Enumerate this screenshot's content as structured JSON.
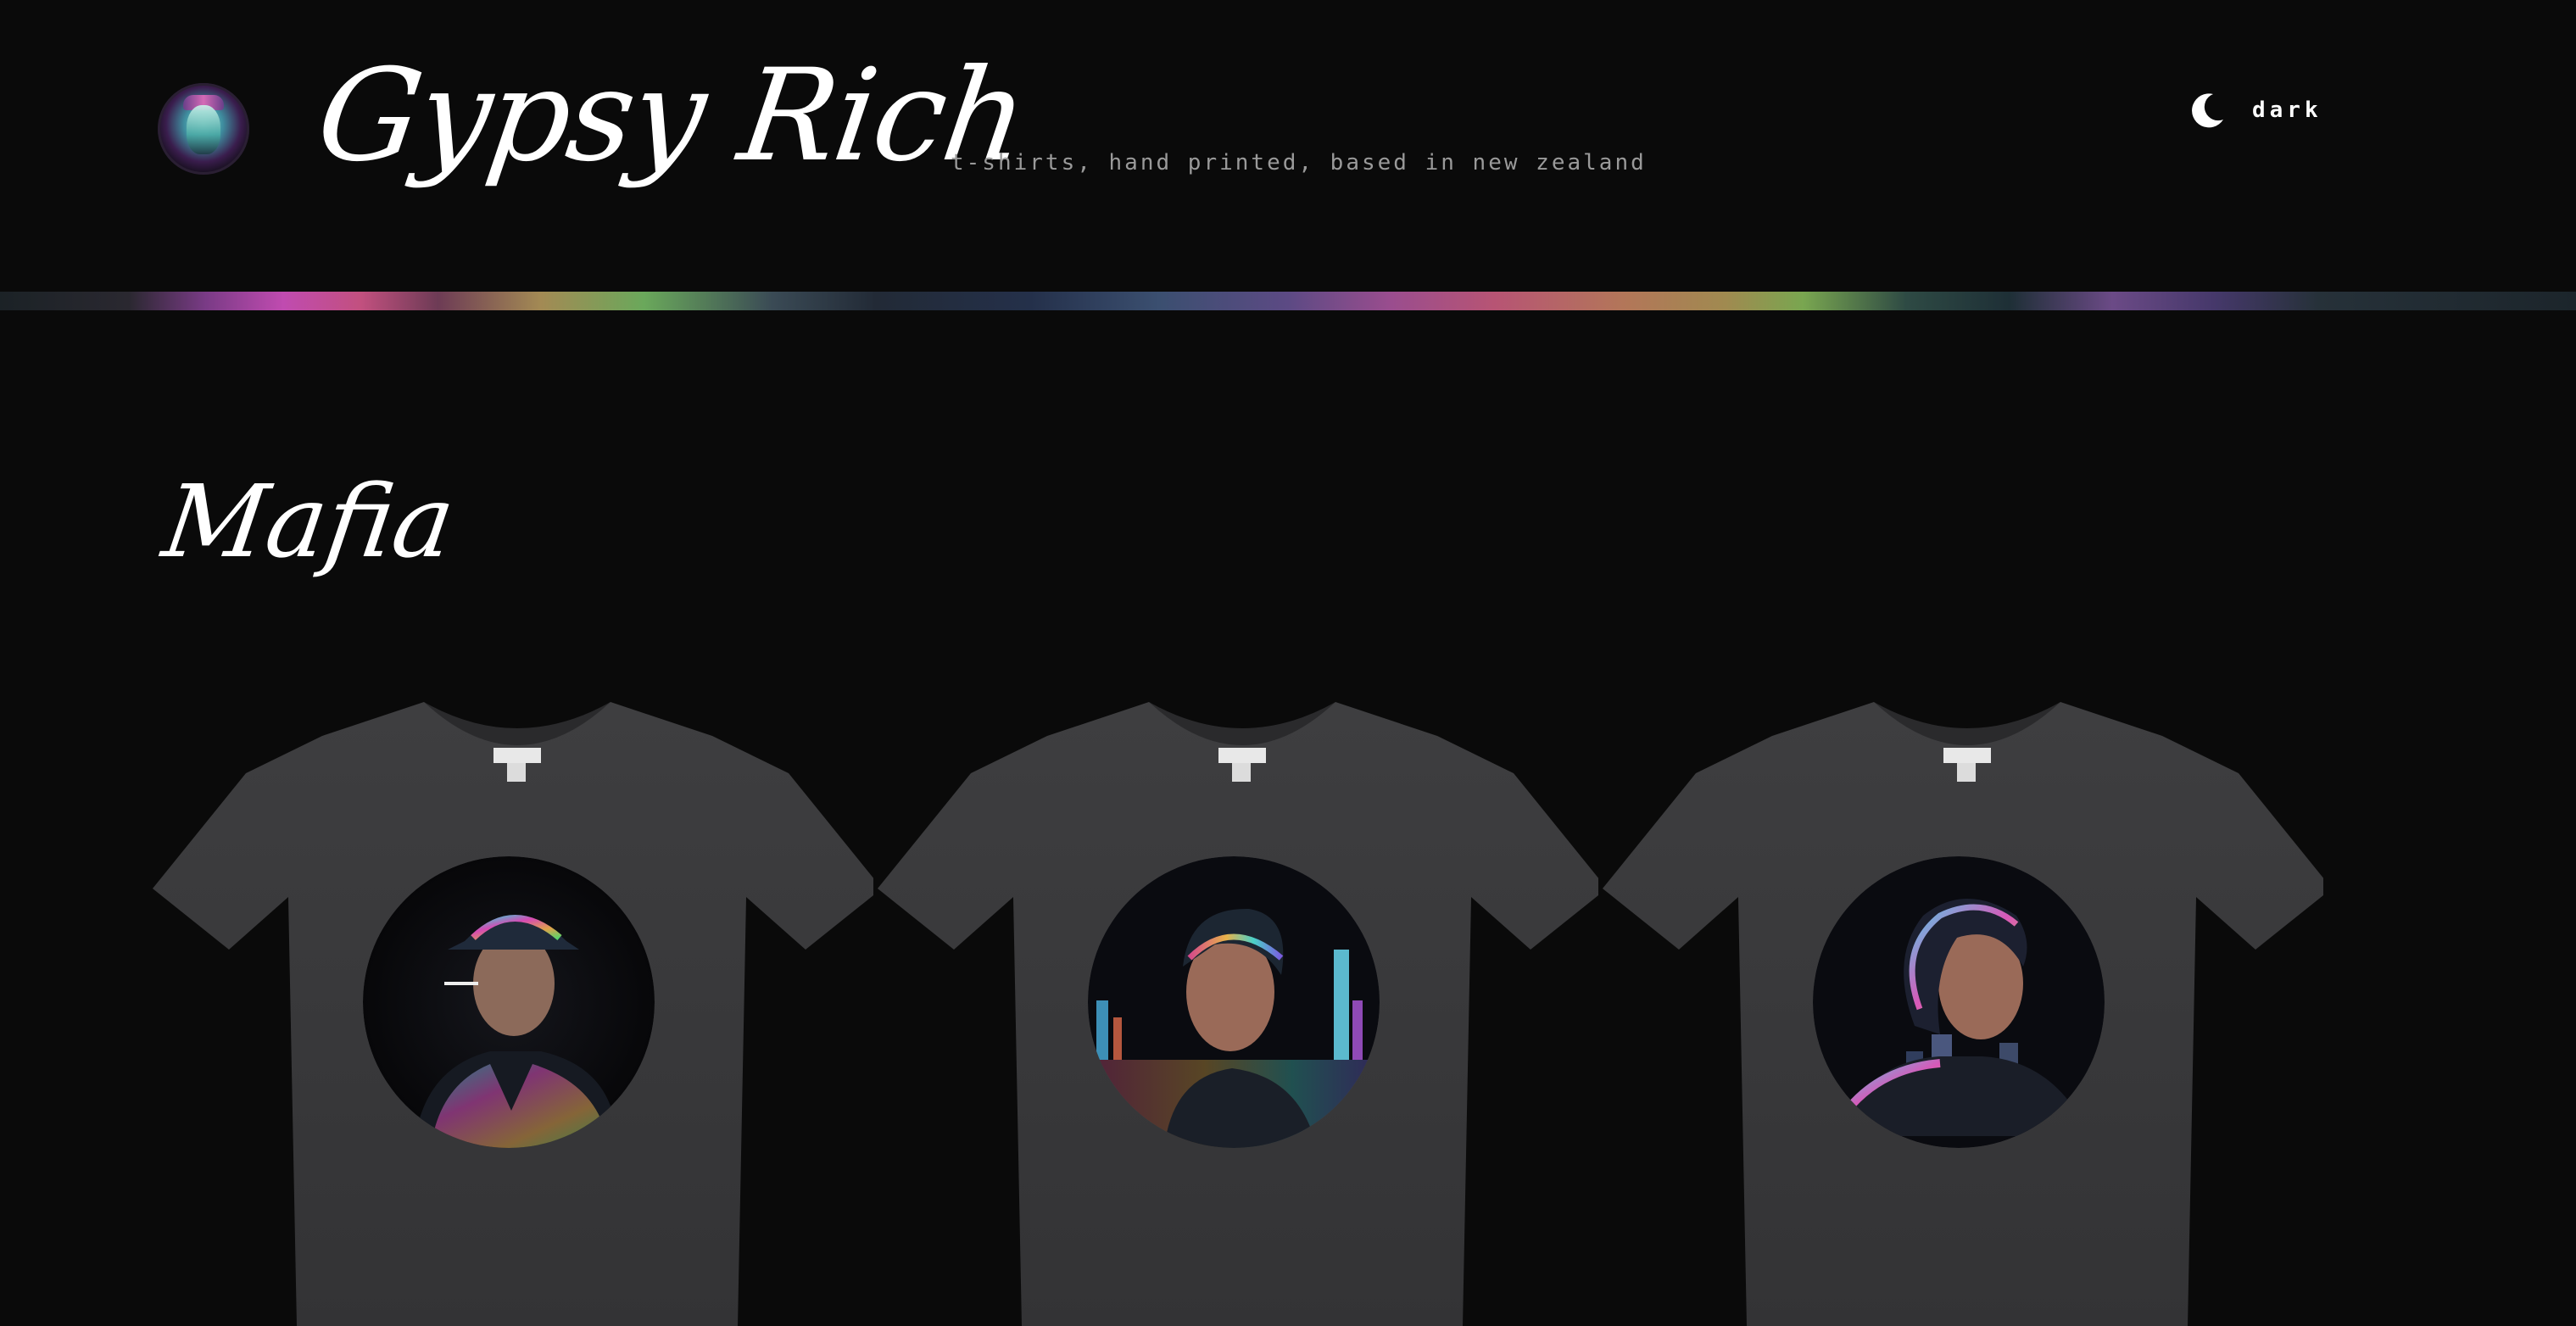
{
  "header": {
    "brand_name": "Gypsy Rich",
    "tagline": "t-shirts, hand printed, based in new zealand",
    "logo_icon": "goddess-medallion-icon",
    "theme_toggle": {
      "icon": "moon-icon",
      "label": "dark"
    }
  },
  "section": {
    "title": "Mafia"
  },
  "products": [
    {
      "icon": "t-shirt-mafia-fedora-print"
    },
    {
      "icon": "t-shirt-mafia-city-skyline-print"
    },
    {
      "icon": "t-shirt-mafia-curly-hair-print"
    }
  ],
  "colors": {
    "background": "#0a0a0a",
    "shirt": "#3a3a3c",
    "tagline": "#9a9a9a",
    "text": "#ffffff"
  }
}
